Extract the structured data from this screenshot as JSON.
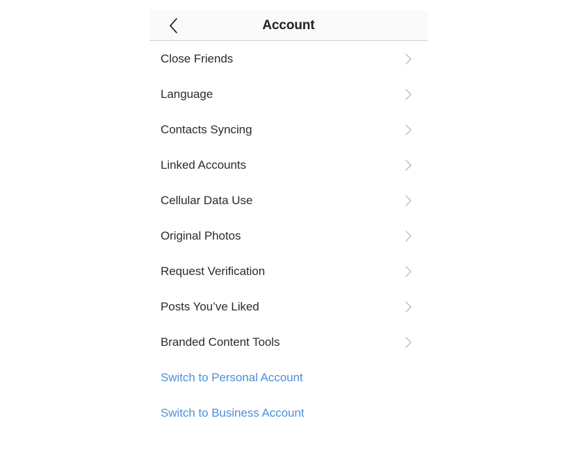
{
  "page": {
    "background_color": "#ffffff",
    "panel_background_color": "#ffffff"
  },
  "navbar": {
    "title": "Account",
    "background_color": "#fafafa",
    "border_color": "#cfcfcf",
    "back_icon": "chevron-left-icon",
    "back_icon_color": "#262626"
  },
  "colors": {
    "label_text": "#2b2b2b",
    "link_blue": "#4a90d9",
    "chevron_gray": "#c7c7c7"
  },
  "list": {
    "chevron_icon": "chevron-right-icon",
    "items": [
      {
        "label": "Close Friends"
      },
      {
        "label": "Language"
      },
      {
        "label": "Contacts Syncing"
      },
      {
        "label": "Linked Accounts"
      },
      {
        "label": "Cellular Data Use"
      },
      {
        "label": "Original Photos"
      },
      {
        "label": "Request Verification"
      },
      {
        "label": "Posts You’ve Liked"
      },
      {
        "label": "Branded Content Tools"
      }
    ]
  },
  "actions": [
    {
      "label": "Switch to Personal Account"
    },
    {
      "label": "Switch to Business Account"
    }
  ]
}
